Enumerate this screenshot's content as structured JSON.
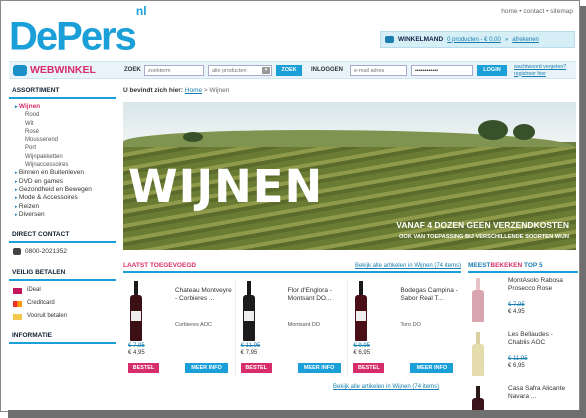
{
  "top_links": "home • contact • sitemap",
  "logo": {
    "text": "DePers",
    "sup": "nl"
  },
  "cart": {
    "label": "WINKELMAND",
    "summary": "0 producten - € 0,00",
    "checkout": "afrekenen"
  },
  "nav": {
    "brand": "WEBWINKEL",
    "search_label": "ZOEK",
    "search_placeholder": "zoekterm",
    "category_select": "alle producten",
    "search_button": "ZOEK",
    "login_label": "INLOGGEN",
    "email_placeholder": "e-mail adres",
    "password_value": "••••••••••••",
    "login_button": "LOGIN",
    "forgot": "wachtwoord vergeten?",
    "register": "registreer hier"
  },
  "sidebar": {
    "assortiment_title": "ASSORTIMENT",
    "categories": [
      {
        "label": "Wijnen",
        "active": true,
        "subs": [
          "Rood",
          "Wit",
          "Rosé",
          "Mousserend",
          "Port",
          "Wijnpakketten",
          "Wijnaccessoires"
        ]
      },
      {
        "label": "Binnen en Buitenleven"
      },
      {
        "label": "DVD en games"
      },
      {
        "label": "Gezondheid en Bewegen"
      },
      {
        "label": "Mode & Accessoires"
      },
      {
        "label": "Reizen"
      },
      {
        "label": "Diversen"
      }
    ],
    "contact_title": "DIRECT CONTACT",
    "phone": "0800-2021352",
    "payment_title": "VEILIG BETALEN",
    "payments": [
      "iDeal",
      "Creditcard",
      "Vooruit betalen"
    ],
    "info_title": "INFORMATIE"
  },
  "breadcrumb": {
    "prefix": "U bevindt zich hier:",
    "home": "Home",
    "current": "Wijnen"
  },
  "hero": {
    "title": "WIJNEN",
    "line1": "VANAF 4 DOZEN GEEN VERZENDKOSTEN",
    "line2": "OOK VAN TOEPASSING BIJ VERSCHILLENDE SOORTEN WIJN"
  },
  "latest": {
    "title": "LAATST TOEGEVOEGD",
    "view_all": "Bekijk alle artikelen in Wijnen (74 items)"
  },
  "products": [
    {
      "name": "Chateau Montveyre - Corbieres ...",
      "origin": "Corbieres AOC",
      "old_price": "€ 7,95",
      "price": "€ 4,95",
      "bottle": "#3a1014"
    },
    {
      "name": "Flor d'Englora - Montsant DO...",
      "origin": "Montsant DO",
      "old_price": "€ 11,95",
      "price": "€ 7,95",
      "bottle": "#1c1c1c"
    },
    {
      "name": "Bodegas Campina - Sabor Real T...",
      "origin": "Toro DO",
      "old_price": "€ 9,95",
      "price": "€ 6,95",
      "bottle": "#4a0f16"
    }
  ],
  "buttons": {
    "order": "BESTEL",
    "more": "MEER INFO"
  },
  "bestseller": {
    "title_a": "MEEST",
    "title_b": "BEKEKEN",
    "title_c": " TOP 5"
  },
  "best_items": [
    {
      "name": "MontAsolo Rabosa Prosecco Rose",
      "old_price": "€ 7,95",
      "price": "€ 4,95",
      "neck": "#e7c2c9",
      "body": "#d8a4ad"
    },
    {
      "name": "Les Bellaudes - Chablis AOC",
      "old_price": "€ 11,95",
      "price": "€ 6,95",
      "neck": "#d9cf9f",
      "body": "#e5dcae"
    },
    {
      "name": "Casa Safra Alicante Navara ...",
      "old_price": "",
      "price": "",
      "neck": "#2a1a1a",
      "body": "#3a1418"
    }
  ]
}
